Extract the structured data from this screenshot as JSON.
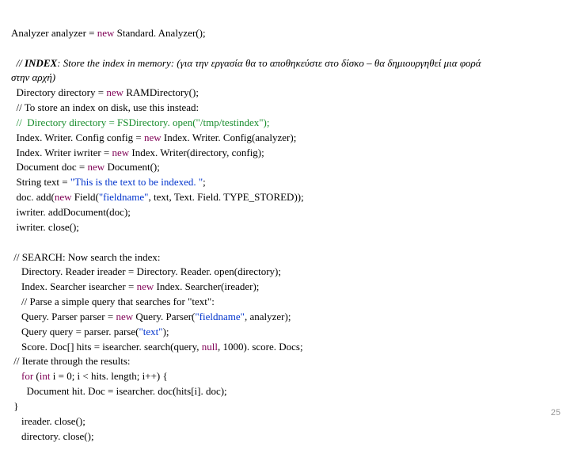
{
  "l1a": "Analyzer analyzer = ",
  "l1b": "new",
  "l1c": " Standard. Analyzer();",
  "l2a": "  // ",
  "l2b": "INDEX",
  "l2c": ": Store the index in memory: (για την εργασία θα το αποθηκεύστε στο δίσκο – θα δημιουργηθεί μια φορά",
  "l3": "στην αρχή)",
  "l4a": "  Directory directory = ",
  "l4b": "new",
  "l4c": " RAMDirectory();",
  "l5": "  // To store an index on disk, use this instead:",
  "l6": "  //  Directory directory = FSDirectory. open(\"/tmp/testindex\");",
  "l7a": "  Index. Writer. Config config = ",
  "l7b": "new",
  "l7c": " Index. Writer. Config(analyzer);",
  "l8a": "  Index. Writer iwriter = ",
  "l8b": "new",
  "l8c": " Index. Writer(directory, config);",
  "l9a": "  Document doc = ",
  "l9b": "new",
  "l9c": " Document();",
  "l10a": "  String text = ",
  "l10b": "\"This is the text to be indexed. \"",
  "l10c": ";",
  "l11a": "  doc. add(",
  "l11b": "new",
  "l11c": " Field(",
  "l11d": "\"fieldname\"",
  "l11e": ", text, Text. Field. ",
  "l11f": "TYPE_STORED",
  "l11g": "));",
  "l12": "  iwriter. addDocument(doc);",
  "l13": "  iwriter. close();",
  "l14": " // SEARCH: Now search the index:",
  "l15": "    Directory. Reader ireader = Directory. Reader. open(directory);",
  "l16a": "    Index. Searcher isearcher = ",
  "l16b": "new",
  "l16c": " Index. Searcher(ireader);",
  "l17": "    // Parse a simple query that searches for \"text\":",
  "l18a": "    Query. Parser parser = ",
  "l18b": "new",
  "l18c": " Query. Parser(",
  "l18d": "\"fieldname\"",
  "l18e": ", analyzer);",
  "l19a": "    Query query = parser. parse(",
  "l19b": "\"text\"",
  "l19c": ");",
  "l20a": "    Score. Doc[] hits = isearcher. search(query, ",
  "l20b": "null",
  "l20c": ", 1000). score. Docs;",
  "l21": " // Iterate through the results:",
  "l22a": "    for",
  "l22b": " (",
  "l22c": "int",
  "l22d": " i = 0; i < hits. length; i++) {",
  "l23": "      Document hit. Doc = isearcher. doc(hits[i]. doc);",
  "l24": " }",
  "l25": "    ireader. close();",
  "l26": "    directory. close();",
  "pagenum": "25"
}
